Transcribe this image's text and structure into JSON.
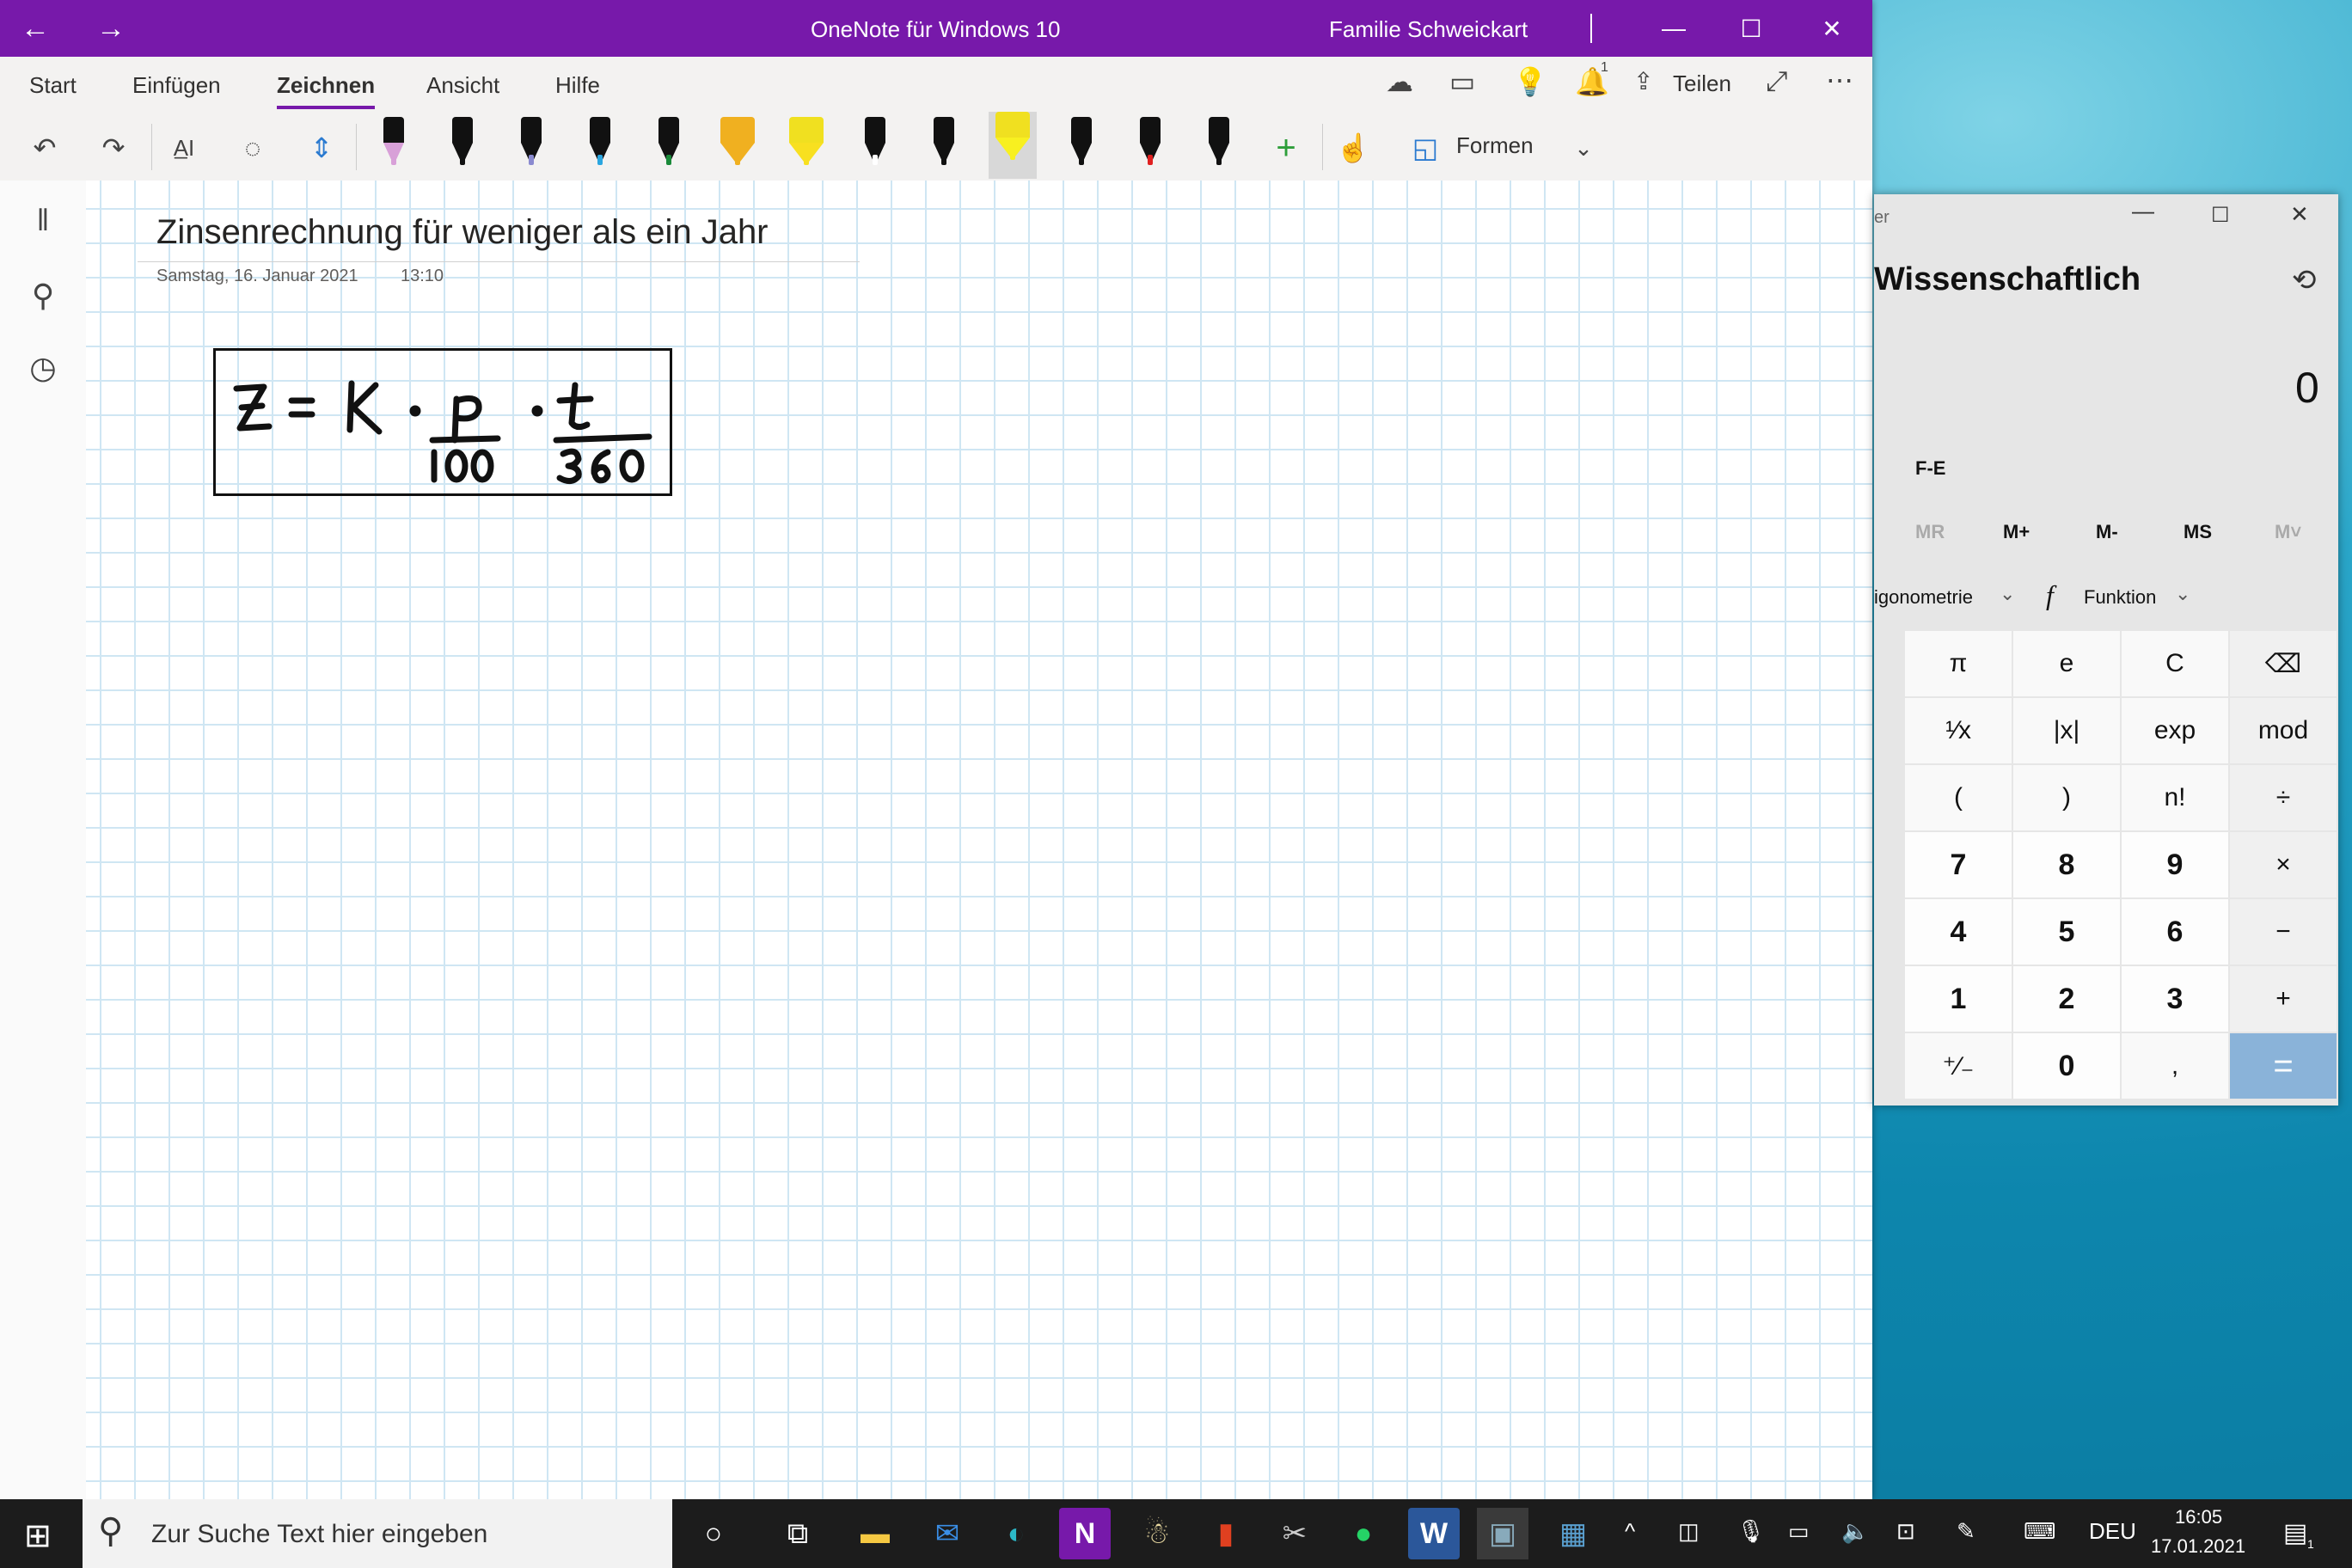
{
  "onenote": {
    "app_title": "OneNote für Windows 10",
    "account": "Familie Schweickart",
    "tabs": [
      "Start",
      "Einfügen",
      "Zeichnen",
      "Ansicht",
      "Hilfe"
    ],
    "active_tab": "Zeichnen",
    "share_label": "Teilen",
    "shapes_label": "Formen",
    "notification_count": "1",
    "pen_colors": [
      "#d8a0d8",
      "#111111",
      "#8a8ad0",
      "#2aa6e0",
      "#1a8a3a",
      "#f0b020",
      "#f8e020",
      "#ffffff",
      "#111111",
      "#f8f020",
      "#111111",
      "#e02020",
      "#111111"
    ],
    "page": {
      "title": "Zinsenrechnung für weniger als ein Jahr",
      "date": "Samstag, 16. Januar 2021",
      "time": "13:10",
      "formula": "Z = K · p/100 · t/360"
    }
  },
  "calculator": {
    "title_fragment": "er",
    "mode": "Wissenschaftlich",
    "display": "0",
    "fe": "F-E",
    "memory": [
      "MR",
      "M+",
      "M-",
      "MS",
      "M˅"
    ],
    "trig_label": "igonometrie",
    "function_label": "Funktion",
    "keys": [
      [
        "π",
        "e",
        "C",
        "⌫"
      ],
      [
        "¹⁄x",
        "|x|",
        "exp",
        "mod"
      ],
      [
        "(",
        ")",
        "n!",
        "÷"
      ],
      [
        "7",
        "8",
        "9",
        "×"
      ],
      [
        "4",
        "5",
        "6",
        "−"
      ],
      [
        "1",
        "2",
        "3",
        "+"
      ],
      [
        "⁺∕₋",
        "0",
        ",",
        "="
      ]
    ]
  },
  "taskbar": {
    "search_placeholder": "Zur Suche Text hier eingeben",
    "language": "DEU",
    "time": "16:05",
    "date": "17.01.2021",
    "notification_count": "1"
  }
}
